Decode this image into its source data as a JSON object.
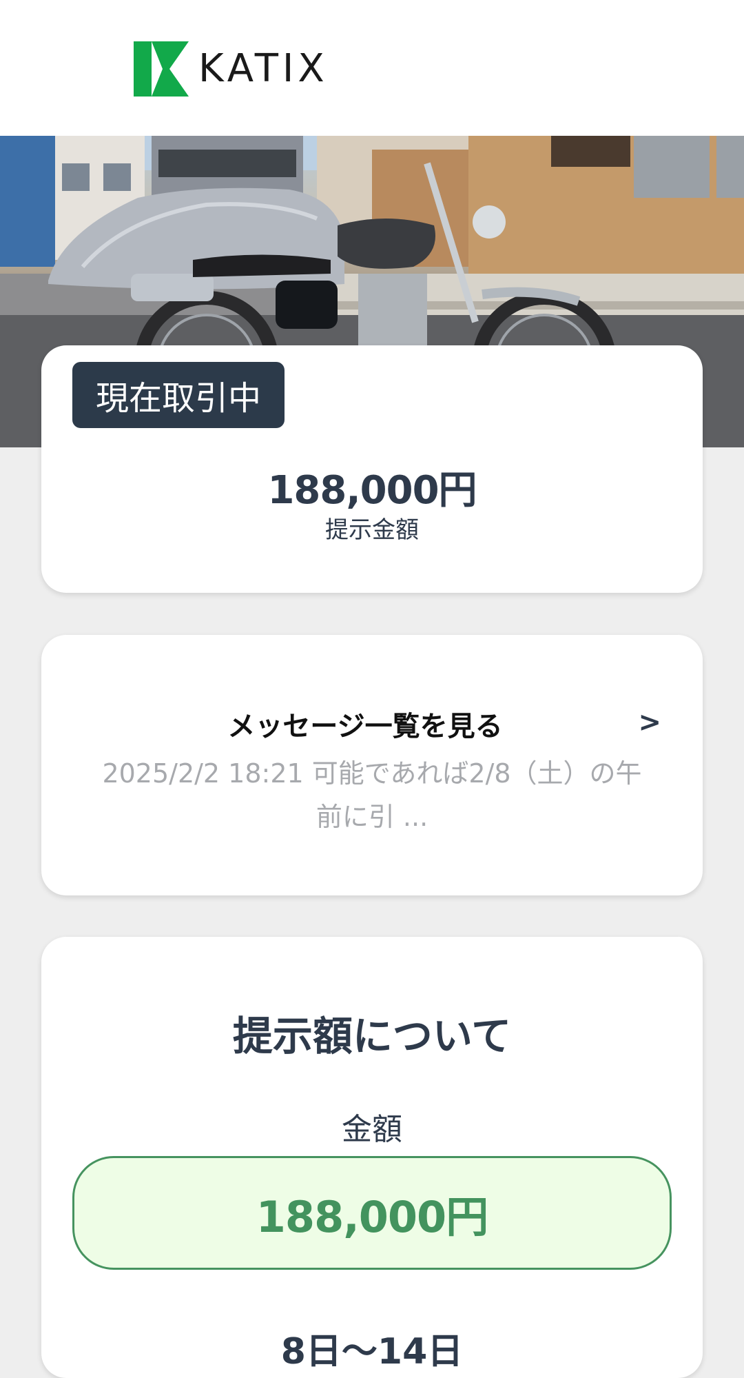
{
  "header": {
    "logo_text": "KATIX",
    "logo_icon": "katix-logo-mark",
    "brand_color": "#12a94a"
  },
  "hero": {
    "image_icon": "motorcycle-photo"
  },
  "status_card": {
    "badge": "現在取引中",
    "offer_price": "188,000円",
    "offer_label": "提示金額"
  },
  "messages_card": {
    "title": "メッセージ一覧を見る",
    "chevron": ">",
    "preview_line1": "2025/2/2 18:21 可能であれば2/8（土）の午",
    "preview_line2": "前に引 ..."
  },
  "about_card": {
    "title": "提示額について",
    "amount_label": "金額",
    "amount_value": "188,000円",
    "period": "8日〜14日"
  },
  "colors": {
    "text_primary": "#2e3a4b",
    "badge_bg": "#2c3a4a",
    "amount_bg": "#eefde6",
    "amount_border": "#46935f",
    "preview_text": "#a7a9ad"
  }
}
